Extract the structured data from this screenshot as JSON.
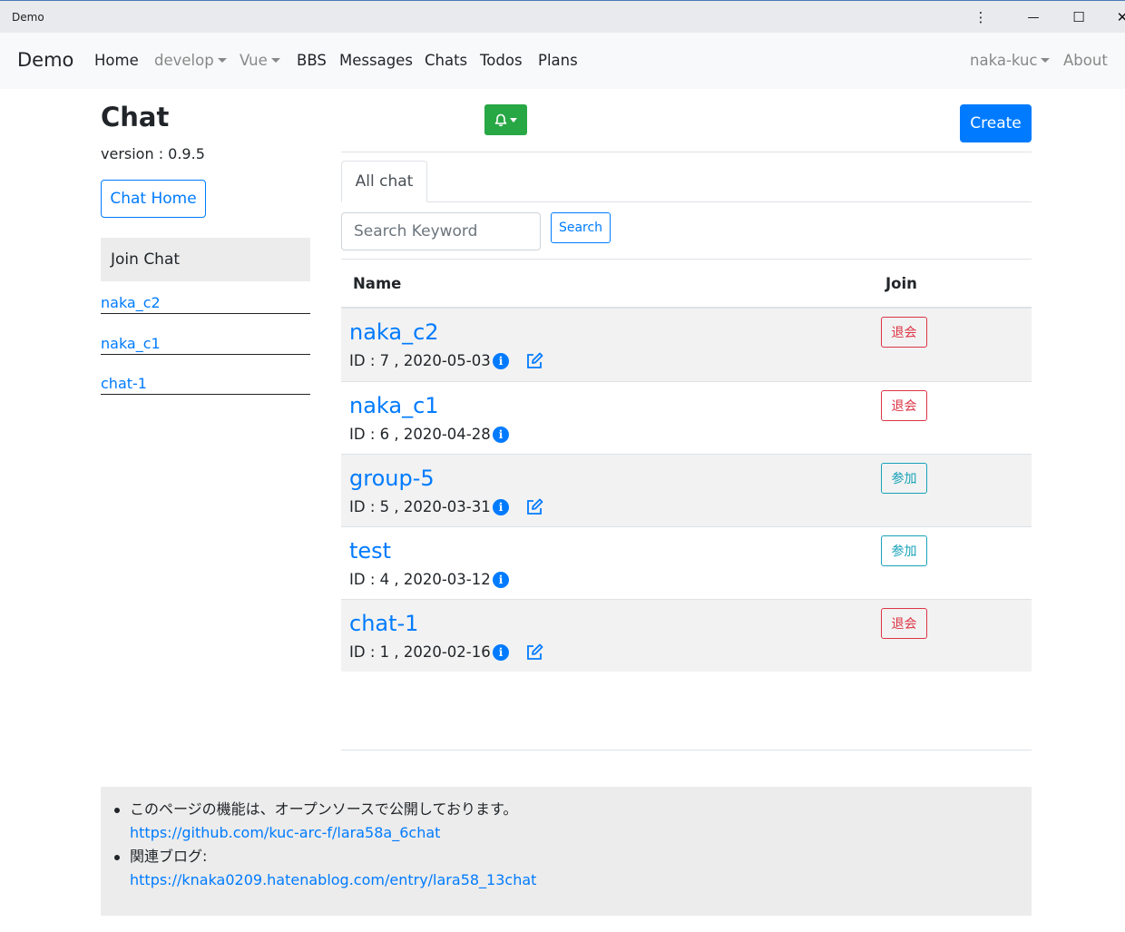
{
  "window": {
    "title": "Demo",
    "controls": {
      "menu": "⋮",
      "minimize": "—",
      "maximize": "☐",
      "close": "✕"
    }
  },
  "navbar": {
    "brand": "Demo",
    "items": [
      {
        "label": "Home",
        "dropdown": false
      },
      {
        "label": "develop",
        "dropdown": true
      },
      {
        "label": "Vue",
        "dropdown": true
      },
      {
        "label": "BBS",
        "dropdown": false
      },
      {
        "label": "Messages",
        "dropdown": false
      },
      {
        "label": "Chats",
        "dropdown": false
      },
      {
        "label": "Todos",
        "dropdown": false
      },
      {
        "label": "Plans",
        "dropdown": false
      }
    ],
    "user": "naka-kuc",
    "about": "About"
  },
  "sidebar": {
    "title": "Chat",
    "version": "version : 0.9.5",
    "home_button": "Chat Home",
    "join_header": "Join Chat",
    "links": [
      "naka_c2",
      "naka_c1",
      "chat-1"
    ]
  },
  "toolbar": {
    "bell_icon": "bell-icon",
    "create_button": "Create"
  },
  "tabs": [
    "All chat"
  ],
  "search": {
    "placeholder": "Search Keyword",
    "value": "",
    "button": "Search"
  },
  "table": {
    "headers": {
      "name": "Name",
      "join": "Join"
    },
    "rows": [
      {
        "name": "naka_c2",
        "meta": "ID : 7 , 2020-05-03",
        "editable": true,
        "action": "退会",
        "action_type": "leave"
      },
      {
        "name": "naka_c1",
        "meta": "ID : 6 , 2020-04-28",
        "editable": false,
        "action": "退会",
        "action_type": "leave"
      },
      {
        "name": "group-5",
        "meta": "ID : 5 , 2020-03-31",
        "editable": true,
        "action": "参加",
        "action_type": "join"
      },
      {
        "name": "test",
        "meta": "ID : 4 , 2020-03-12",
        "editable": false,
        "action": "参加",
        "action_type": "join"
      },
      {
        "name": "chat-1",
        "meta": "ID : 1 , 2020-02-16",
        "editable": true,
        "action": "退会",
        "action_type": "leave"
      }
    ]
  },
  "footer": {
    "items": [
      {
        "text": "このページの機能は、オープンソースで公開しております。",
        "link": "https://github.com/kuc-arc-f/lara58a_6chat"
      },
      {
        "text": "関連ブログ:",
        "link": "https://knaka0209.hatenablog.com/entry/lara58_13chat"
      }
    ]
  },
  "colors": {
    "primary": "#007bff",
    "success": "#28a745",
    "danger": "#dc3545",
    "info": "#17a2b8"
  }
}
